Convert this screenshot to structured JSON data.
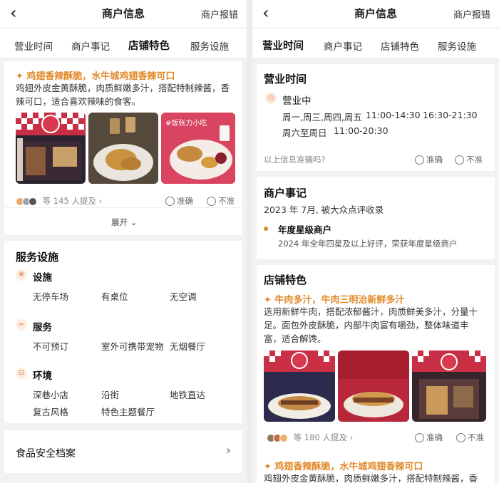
{
  "left": {
    "header": {
      "back": "‹",
      "title": "商户信息",
      "report": "商户报错"
    },
    "tabs": [
      "营业时间",
      "商户事记",
      "店铺特色",
      "服务设施"
    ],
    "feature": {
      "title": "✦ 鸡翅香辣酥脆，水牛城鸡翅香辣可口",
      "lines": [
        "鸡翅外皮金黄酥脆，肉质鲜嫩多汁，搭配特制辣酱，香",
        "辣可口，适合喜欢辣味的食客。"
      ],
      "photo_tag": "#饭张力小吃",
      "mentions": "等 145 人提及 ›",
      "accurate": "准确",
      "inaccurate": "不准",
      "expand": "展开 ⌄"
    },
    "services": {
      "title": "服务设施",
      "groups": [
        {
          "label": "设施",
          "icon": "facility-icon",
          "items": [
            "无停车场",
            "有桌位",
            "无空调"
          ]
        },
        {
          "label": "服务",
          "icon": "service-icon",
          "items": [
            "不可预订",
            "室外可携带宠物",
            "无烟餐厅"
          ]
        },
        {
          "label": "环境",
          "icon": "environment-icon",
          "items": [
            "深巷小店",
            "沿街",
            "地铁直达",
            "复古风格",
            "特色主题餐厅"
          ]
        }
      ]
    },
    "food_safety": {
      "label": "食品安全档案",
      "arrow": "›"
    }
  },
  "right": {
    "header": {
      "back": "‹",
      "title": "商户信息",
      "report": "商户报错"
    },
    "tabs": [
      "营业时间",
      "商户事记",
      "店铺特色",
      "服务设施"
    ],
    "hours": {
      "title": "营业时间",
      "status": "营业中",
      "row1_days": "周一,周三,周四,周五",
      "row1_time1": "11:00-14:30",
      "row1_time2": "16:30-21:30",
      "row2_days": "周六至周日",
      "row2_time": "11:00-20:30",
      "question": "以上信息准确吗?",
      "accurate": "准确",
      "inaccurate": "不准"
    },
    "events": {
      "title": "商户事记",
      "date_line": "2023 年 7月, 被大众点评收录",
      "badge_title": "年度星级商户",
      "badge_desc": "2024 年全年四星及以上好评，荣获年度星级商户"
    },
    "features": {
      "title": "店铺特色",
      "item_title": "✦ 牛肉多汁，牛肉三明治新鲜多汁",
      "lines": [
        "选用新鲜牛肉，搭配浓郁酱汁，肉质鲜美多汁，分量十",
        "足。面包外皮酥脆，内部牛肉富有嚼劲，整体味道丰",
        "富，适合解馋。"
      ],
      "mentions": "等 180 人提及 ›",
      "accurate": "准确",
      "inaccurate": "不准",
      "item2_title": "✦ 鸡翅香辣酥脆，水牛城鸡翅香辣可口",
      "item2_line": "鸡翅外皮金黄酥脆，肉质鲜嫩多汁，搭配特制辣酱，香"
    }
  }
}
